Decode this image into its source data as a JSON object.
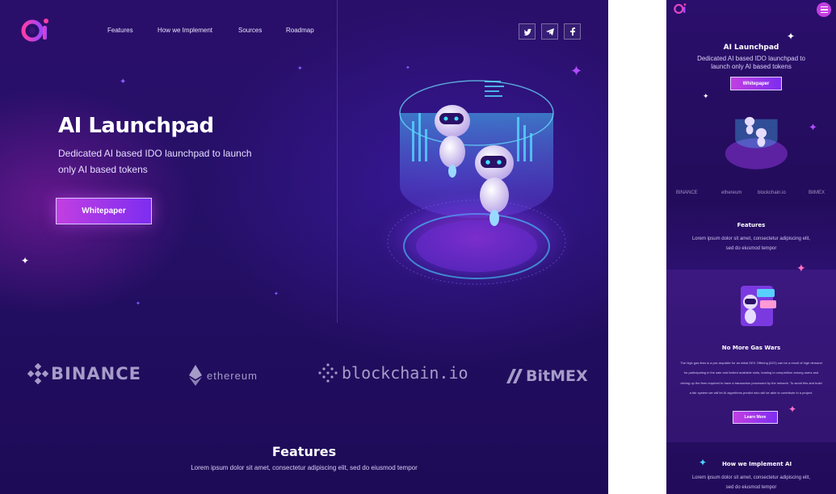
{
  "brand": {
    "logo_text": "ai"
  },
  "nav": {
    "items": [
      "Features",
      "How we Implement",
      "Sources",
      "Roadmap"
    ]
  },
  "social": {
    "icons": [
      "twitter-icon",
      "telegram-icon",
      "facebook-icon"
    ]
  },
  "hero": {
    "title": "AI Launchpad",
    "subtitle": "Dedicated AI based IDO launchpad to launch only AI based tokens",
    "button": "Whitepaper"
  },
  "partners": [
    "BINANCE",
    "ethereum",
    "blockchain.io",
    "BitMEX"
  ],
  "features": {
    "title": "Features",
    "subtitle": "Lorem ipsum dolor sit amet, consectetur adipiscing elit, sed do eiusmod tempor"
  },
  "mobile": {
    "hero_title": "AI Launchpad",
    "hero_subtitle": "Dedicated AI based IDO launchpad to launch only AI based tokens",
    "hero_button": "Whitepaper",
    "partners": [
      "BINANCE",
      "ethereum",
      "blockchain.io",
      "BitMEX"
    ],
    "features_title": "Features",
    "features_sub": "Lorem ipsum dolor sit amet, consectetur adipiscing elit, sed do eiusmod tempor",
    "gas_title": "No More Gas Wars",
    "gas_text": "The high gas fees is a pre-requisite for an initial DEX Offering (IDO) can be a result of high demand for participating in the sale and limited available slots, leading to competition among users and driving up the fees required to have a transaction processed by the network. To avoid this and build a fair system we will let AI algorithms predict who will be able to contribute in a project.",
    "learn_more": "Learn More",
    "implement_title": "How we Implement AI",
    "implement_sub": "Lorem ipsum dolor sit amet, consectetur adipiscing elit, sed do eiusmod tempor"
  },
  "colors": {
    "accent": "#c23fe2",
    "accent2": "#7d2df0",
    "bg": "#250f66"
  }
}
